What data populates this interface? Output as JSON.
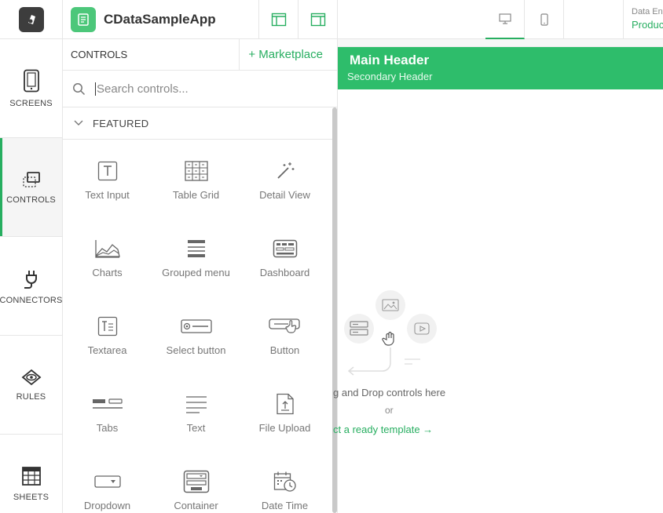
{
  "app": {
    "title": "CDataSampleApp"
  },
  "data_env": {
    "label": "Data Env",
    "value": "Produc"
  },
  "nav": [
    {
      "label": "SCREENS",
      "icon": "tablet-icon"
    },
    {
      "label": "CONTROLS",
      "icon": "controls-icon"
    },
    {
      "label": "CONNECTORS",
      "icon": "plug-icon"
    },
    {
      "label": "RULES",
      "icon": "eye-icon"
    },
    {
      "label": "SHEETS",
      "icon": "sheet-icon"
    }
  ],
  "panel": {
    "title": "CONTROLS",
    "marketplace": "+ Marketplace",
    "search_placeholder": "Search controls...",
    "section": "FEATURED",
    "controls": [
      {
        "label": "Text Input",
        "icon": "text-input-icon"
      },
      {
        "label": "Table Grid",
        "icon": "table-grid-icon"
      },
      {
        "label": "Detail View",
        "icon": "magic-wand-icon"
      },
      {
        "label": "Charts",
        "icon": "area-chart-icon"
      },
      {
        "label": "Grouped menu",
        "icon": "grouped-menu-icon"
      },
      {
        "label": "Dashboard",
        "icon": "dashboard-icon"
      },
      {
        "label": "Textarea",
        "icon": "textarea-icon"
      },
      {
        "label": "Select button",
        "icon": "select-button-icon"
      },
      {
        "label": "Button",
        "icon": "button-icon"
      },
      {
        "label": "Tabs",
        "icon": "tabs-icon"
      },
      {
        "label": "Text",
        "icon": "text-lines-icon"
      },
      {
        "label": "File Upload",
        "icon": "file-upload-icon"
      },
      {
        "label": "Dropdown",
        "icon": "dropdown-icon"
      },
      {
        "label": "Container",
        "icon": "container-icon"
      },
      {
        "label": "Date Time",
        "icon": "calendar-clock-icon"
      }
    ]
  },
  "canvas": {
    "main_header": "Main Header",
    "secondary_header": "Secondary Header",
    "drop_text": "g and Drop controls here",
    "or": "or",
    "template_link": "ct a ready template →"
  },
  "colors": {
    "accent": "#27ae60",
    "header_bg": "#2ebd6b"
  }
}
